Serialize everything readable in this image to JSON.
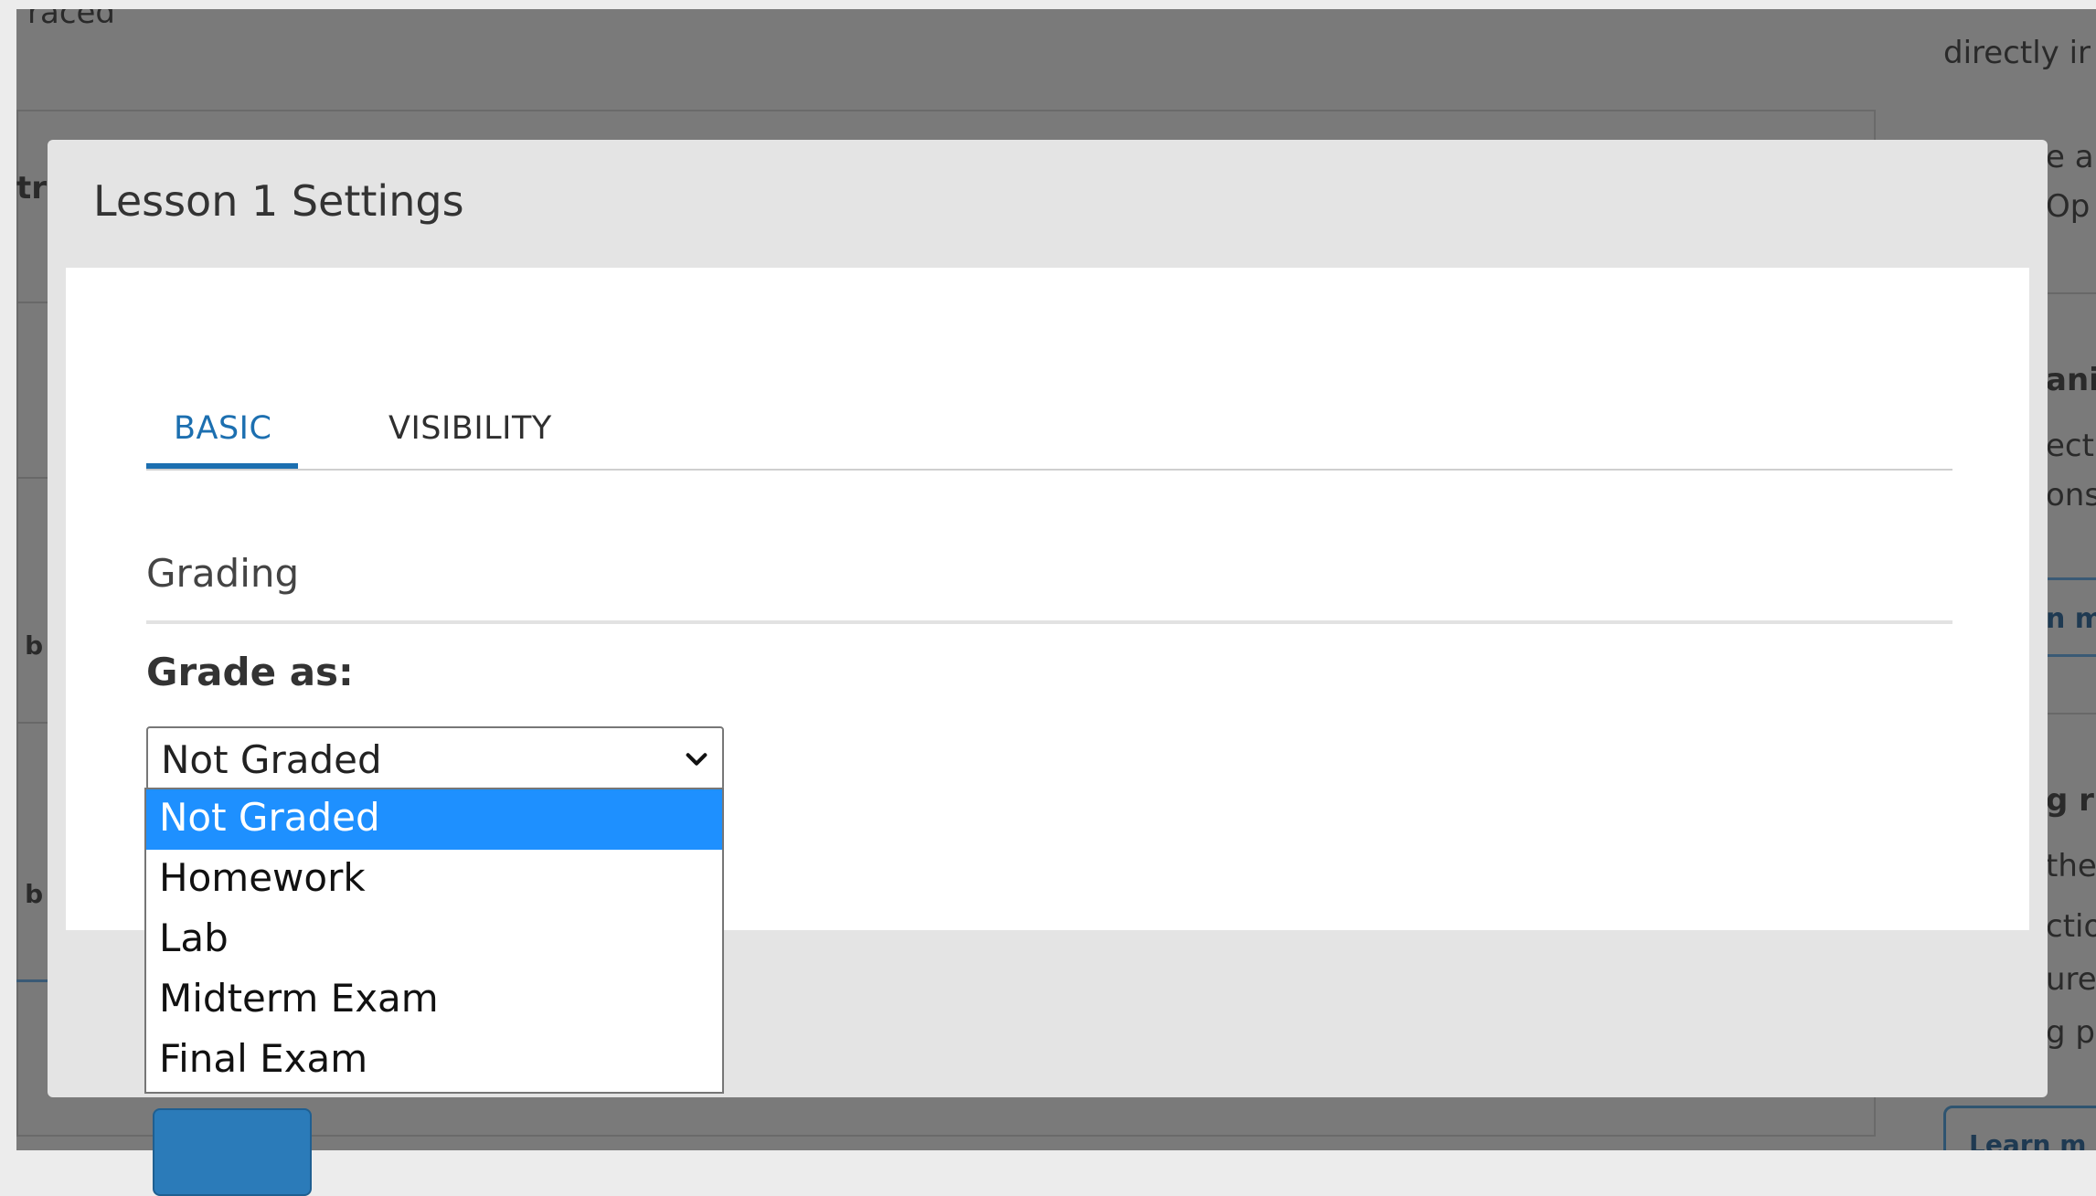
{
  "background": {
    "text_top_left": "raced",
    "text_right_1": "directly ir",
    "text_right_2": "e a",
    "text_right_3": "Op",
    "text_left_heading": "tr",
    "text_right_4": "ani",
    "text_right_5": "ect",
    "text_right_6": "ons",
    "text_right_link": "n m",
    "text_left_b1": "t b",
    "text_left_b2": "t b",
    "text_right_7": "g r",
    "text_right_8": "the",
    "text_right_9": "ctio",
    "text_right_10": "ure",
    "text_right_11": "g p",
    "text_right_learn": "Learn m"
  },
  "modal": {
    "title": "Lesson 1 Settings",
    "tabs": [
      {
        "label": "BASIC",
        "active": true
      },
      {
        "label": "VISIBILITY",
        "active": false
      }
    ],
    "section_title": "Grading",
    "grade_label": "Grade as:",
    "select": {
      "value": "Not Graded",
      "options": [
        "Not Graded",
        "Homework",
        "Lab",
        "Midterm Exam",
        "Final Exam"
      ],
      "selected_index": 0
    }
  },
  "colors": {
    "accent": "#1c6fb0",
    "selected_option": "#1e90ff",
    "overlay": "#7a7a7a"
  }
}
